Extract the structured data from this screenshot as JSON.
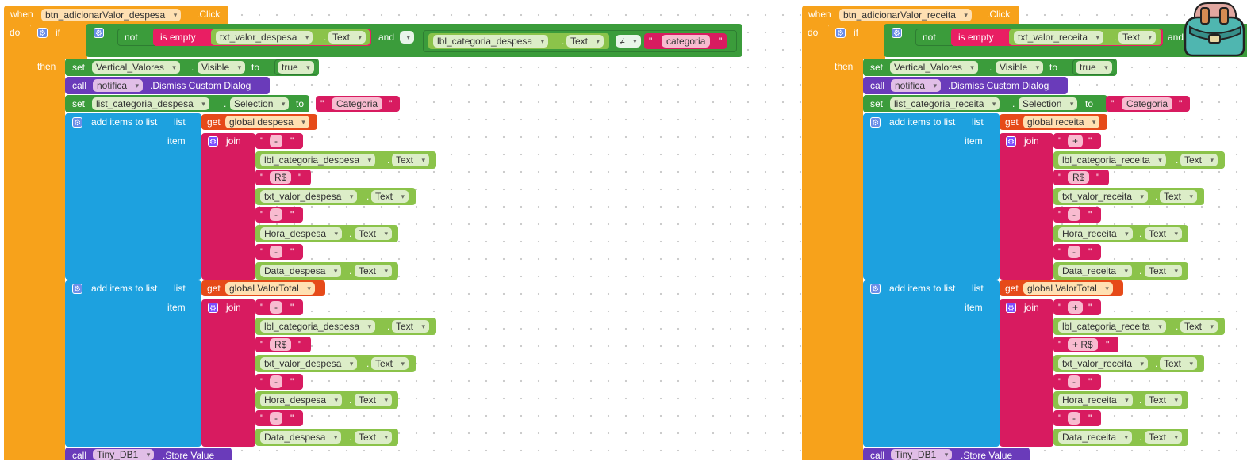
{
  "kw": {
    "when": "when",
    "do": "do",
    "if": "if",
    "then": "then",
    "not": "not",
    "is_empty": "is empty",
    "and": "and",
    "ne": "≠",
    "set": "set",
    "to": "to",
    "call": "call",
    "add_items": "add items to list",
    "list": "list",
    "item": "item",
    "get": "get",
    "join": "join",
    "dot": ".",
    "quote": "\""
  },
  "left": {
    "event_component": "btn_adicionarValor_despesa",
    "event_name": ".Click",
    "txt_valor": "txt_valor_despesa",
    "lbl_categoria": "lbl_categoria_despesa",
    "prop_text": "Text",
    "categoria_str": "categoria",
    "vertical": "Vertical_Valores",
    "visible": "Visible",
    "true": "true",
    "notifica": "notifica",
    "dismiss": ".Dismiss Custom Dialog",
    "list_categoria": "list_categoria_despesa",
    "selection": "Selection",
    "categoria_cap": "Categoria",
    "global1": "global despesa",
    "global2": "global ValorTotal",
    "sign": "-",
    "rs": "R$",
    "rs2": "R$",
    "hora": "Hora_despesa",
    "data": "Data_despesa",
    "sep": "-",
    "tinydb": "Tiny_DB1",
    "store": ".Store Value"
  },
  "right": {
    "event_component": "btn_adicionarValor_receita",
    "event_name": ".Click",
    "txt_valor": "txt_valor_receita",
    "prop_text": "Text",
    "and_partial": "and",
    "vertical": "Vertical_Valores",
    "visible": "Visible",
    "true": "true",
    "notifica": "notifica",
    "dismiss": ".Dismiss Custom Dialog",
    "list_categoria": "list_categoria_receita",
    "selection": "Selection",
    "categoria_cap": "Categoria",
    "global1": "global receita",
    "global2": "global ValorTotal",
    "lbl_categoria": "lbl_categoria_receita",
    "sign": "+",
    "rs": "R$",
    "rs2": "+ R$",
    "hora": "Hora_receita",
    "data": "Data_receita",
    "sep": "-",
    "tinydb": "Tiny_DB1",
    "store": ".Store Value"
  },
  "colors": {
    "event": "#f7a21b",
    "control": "#f7a21b",
    "logic": "#3b9c3b",
    "text": "#d81b60",
    "component_prop": "#8bc34a",
    "call": "#6a3bba",
    "lists": "#1da1df",
    "variables": "#e64a19"
  },
  "icons": [
    "gear-icon",
    "dropdown-arrow-icon",
    "backpack-icon"
  ]
}
